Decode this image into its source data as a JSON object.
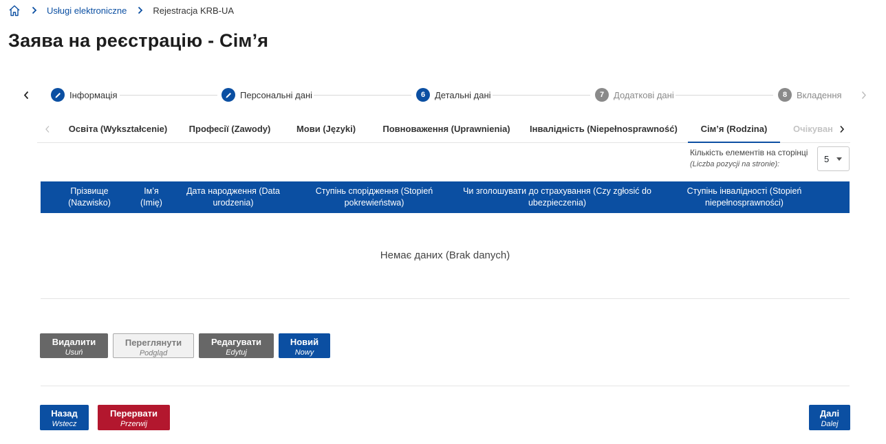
{
  "breadcrumb": {
    "items": [
      "Usługi elektroniczne",
      "Rejestracja KRB-UA"
    ]
  },
  "page": {
    "title": "Заява на реєстрацію - Сім’я"
  },
  "stepper": {
    "steps": [
      {
        "number": "",
        "label": "Інформація",
        "state": "done"
      },
      {
        "number": "",
        "label": "Персональні дані",
        "state": "done"
      },
      {
        "number": "6",
        "label": "Детальні дані",
        "state": "active"
      },
      {
        "number": "7",
        "label": "Додаткові дані",
        "state": "pending"
      },
      {
        "number": "8",
        "label": "Вкладення",
        "state": "pending"
      }
    ]
  },
  "tabs": {
    "items": [
      {
        "label": "Освіта (Wykształcenie)"
      },
      {
        "label": "Професії (Zawody)"
      },
      {
        "label": "Мови (Języki)"
      },
      {
        "label": "Повноваження (Uprawnienia)"
      },
      {
        "label": "Інвалідність (Niepełnosprawność)"
      },
      {
        "label": "Сім’я (Rodzina)",
        "active": true
      },
      {
        "label": "Очікуван"
      }
    ]
  },
  "pagination": {
    "label_uk": "Кількість елементів на сторінці",
    "label_pl": "(Liczba pozycji na stronie):",
    "value": "5"
  },
  "table": {
    "columns": [
      {
        "line1": "Прізвище",
        "line2": "(Nazwisko)"
      },
      {
        "line1": "Ім’я",
        "line2": "(Imię)"
      },
      {
        "line1": "Дата народження (Data",
        "line2": "urodzenia)"
      },
      {
        "line1": "Ступінь спорідження (Stopień",
        "line2": "pokrewieństwa)"
      },
      {
        "line1": "Чи зголошувати до страхування (Czy zgłosić do",
        "line2": "ubezpieczenia)"
      },
      {
        "line1": "Ступінь інвалідності (Stopień",
        "line2": "niepełnosprawności)"
      }
    ],
    "empty_text": "Немає даних (Brak danych)"
  },
  "actions": {
    "delete": {
      "main": "Видалити",
      "sub": "Usuń"
    },
    "view": {
      "main": "Переглянути",
      "sub": "Podgląd"
    },
    "edit": {
      "main": "Редагувати",
      "sub": "Edytuj"
    },
    "new": {
      "main": "Новий",
      "sub": "Nowy"
    }
  },
  "navigation": {
    "back": {
      "main": "Назад",
      "sub": "Wstecz"
    },
    "abort": {
      "main": "Перервати",
      "sub": "Przerwij"
    },
    "next": {
      "main": "Далі",
      "sub": "Dalej"
    }
  },
  "colors": {
    "primary": "#0b4fa2",
    "danger": "#b3172e",
    "neutral": "#676767"
  }
}
